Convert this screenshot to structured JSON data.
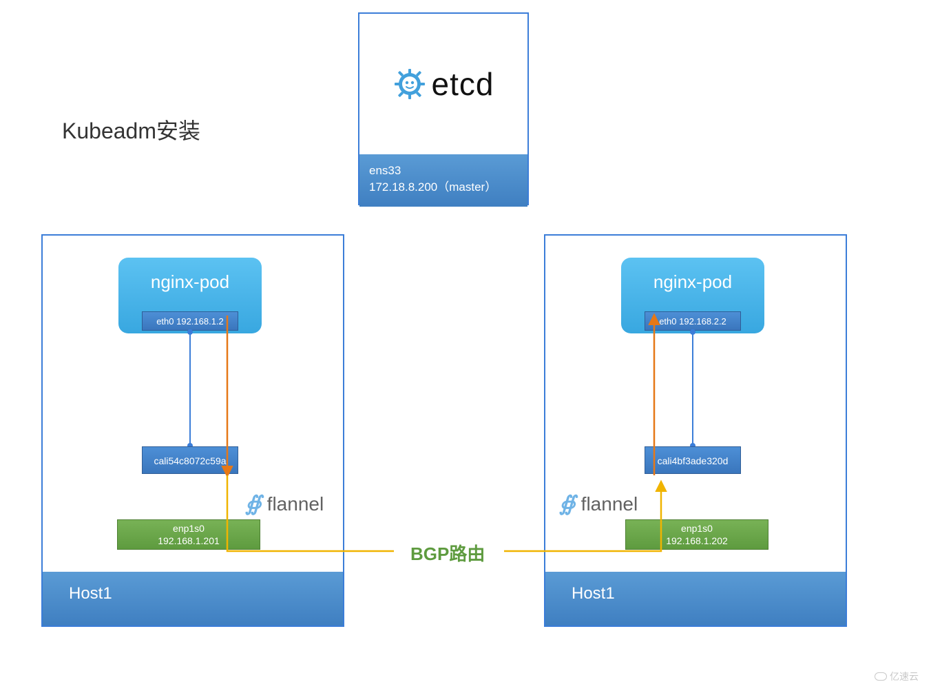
{
  "title": "Kubeadm安装",
  "master": {
    "logo_text": "etcd",
    "iface": "ens33",
    "ip_line": "172.18.8.200（master）"
  },
  "bgp_label": "BGP路由",
  "watermark": "亿速云",
  "hosts": [
    {
      "label": "Host1",
      "pod_name": "nginx-pod",
      "eth_label": "eth0 192.168.1.2",
      "cali_label": "cali54c8072c59a",
      "flannel_label": "flannel",
      "enp_iface": "enp1s0",
      "enp_ip": "192.168.1.201"
    },
    {
      "label": "Host1",
      "pod_name": "nginx-pod",
      "eth_label": "eth0 192.168.2.2",
      "cali_label": "cali4bf3ade320d",
      "flannel_label": "flannel",
      "enp_iface": "enp1s0",
      "enp_ip": "192.168.1.202"
    }
  ],
  "colors": {
    "blue_primary": "#3b7dd8",
    "blue_light": "#5cc2f2",
    "green": "#5e9b3f",
    "orange": "#e67817",
    "yellow": "#f0b400"
  }
}
